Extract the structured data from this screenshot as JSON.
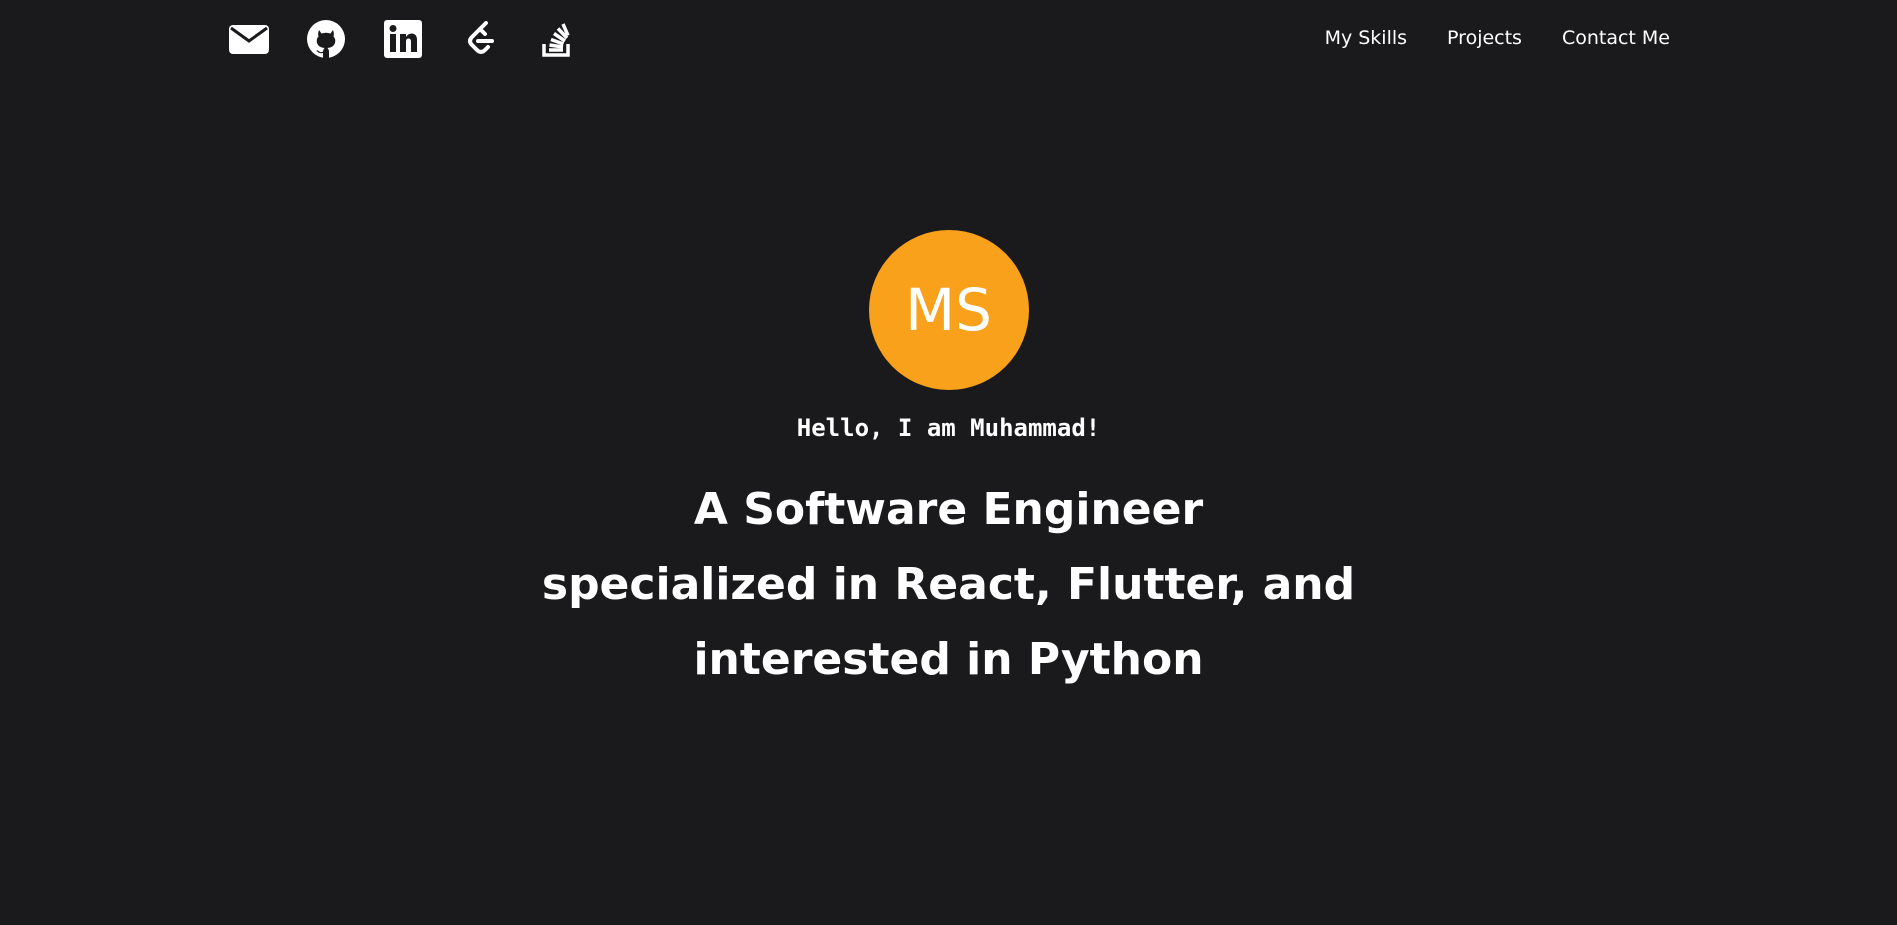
{
  "social": [
    {
      "name": "email",
      "icon": "envelope-icon"
    },
    {
      "name": "github",
      "icon": "github-icon"
    },
    {
      "name": "linkedin",
      "icon": "linkedin-icon"
    },
    {
      "name": "leetcode",
      "icon": "leetcode-icon"
    },
    {
      "name": "stackoverflow",
      "icon": "stackoverflow-icon"
    }
  ],
  "nav": {
    "skills": "My Skills",
    "projects": "Projects",
    "contact": "Contact Me"
  },
  "hero": {
    "avatar_initials": "MS",
    "greeting": "Hello, I am Muhammad!",
    "headline_lines": [
      "A Software Engineer",
      "specialized in React, Flutter, and",
      "interested in Python"
    ]
  },
  "colors": {
    "background": "#1a1a1c",
    "accent": "#f9a11b",
    "text": "#ffffff"
  }
}
